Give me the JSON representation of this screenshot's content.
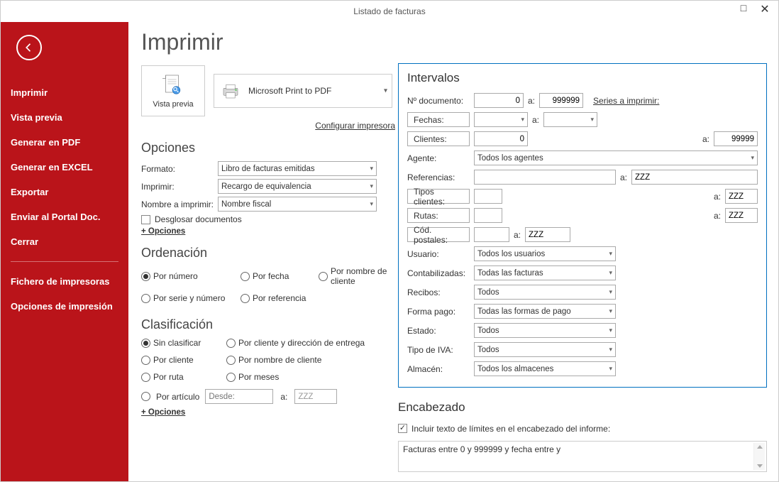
{
  "window": {
    "title": "Listado de facturas"
  },
  "sidebar": {
    "items": [
      "Imprimir",
      "Vista previa",
      "Generar en PDF",
      "Generar en EXCEL",
      "Exportar",
      "Enviar al Portal Doc.",
      "Cerrar"
    ],
    "items2": [
      "Fichero de impresoras",
      "Opciones de impresión"
    ]
  },
  "page": {
    "title": "Imprimir",
    "preview_label": "Vista previa",
    "printer_name": "Microsoft Print to PDF",
    "config_link": "Configurar impresora"
  },
  "opciones": {
    "heading": "Opciones",
    "formato_label": "Formato:",
    "formato_value": "Libro de facturas emitidas",
    "imprimir_label": "Imprimir:",
    "imprimir_value": "Recargo de equivalencia",
    "nombre_label": "Nombre a imprimir:",
    "nombre_value": "Nombre fiscal",
    "desglosar_label": "Desglosar documentos",
    "mas_opciones": "+ Opciones"
  },
  "ordenacion": {
    "heading": "Ordenación",
    "por_numero": "Por número",
    "por_fecha": "Por fecha",
    "por_nombre_cliente": "Por nombre de cliente",
    "por_serie_numero": "Por serie y número",
    "por_referencia": "Por referencia"
  },
  "clasificacion": {
    "heading": "Clasificación",
    "sin_clasificar": "Sin clasificar",
    "por_cliente_entrega": "Por cliente y dirección de entrega",
    "por_cliente": "Por cliente",
    "por_nombre_cliente": "Por nombre de cliente",
    "por_ruta": "Por ruta",
    "por_meses": "Por meses",
    "por_articulo": "Por artículo",
    "desde_ph": "Desde:",
    "a_label": "a:",
    "a_value": "ZZZ",
    "mas_opciones": "+ Opciones"
  },
  "intervalos": {
    "heading": "Intervalos",
    "n_doc_label": "Nº documento:",
    "n_doc_from": "0",
    "a": "a:",
    "n_doc_to": "999999",
    "series_link": "Series a imprimir:",
    "fechas_label": "Fechas:",
    "clientes_label": "Clientes:",
    "clientes_from": "0",
    "clientes_to": "99999",
    "agente_label": "Agente:",
    "agente_value": "Todos los agentes",
    "referencias_label": "Referencias:",
    "referencias_to": "ZZZ",
    "tipos_clientes_label": "Tipos clientes:",
    "tipos_clientes_to": "ZZZ",
    "rutas_label": "Rutas:",
    "rutas_to": "ZZZ",
    "cod_postales_label": "Cód. postales:",
    "cod_postales_to": "ZZZ",
    "usuario_label": "Usuario:",
    "usuario_value": "Todos los usuarios",
    "contabilizadas_label": "Contabilizadas:",
    "contabilizadas_value": "Todas las facturas",
    "recibos_label": "Recibos:",
    "recibos_value": "Todos",
    "forma_pago_label": "Forma pago:",
    "forma_pago_value": "Todas las formas de pago",
    "estado_label": "Estado:",
    "estado_value": "Todos",
    "tipo_iva_label": "Tipo de IVA:",
    "tipo_iva_value": "Todos",
    "almacen_label": "Almacén:",
    "almacen_value": "Todos los almacenes"
  },
  "encabezado": {
    "heading": "Encabezado",
    "incluir_label": "Incluir texto de límites en el encabezado del informe:",
    "text": "Facturas entre 0 y 999999 y fecha entre  y "
  }
}
